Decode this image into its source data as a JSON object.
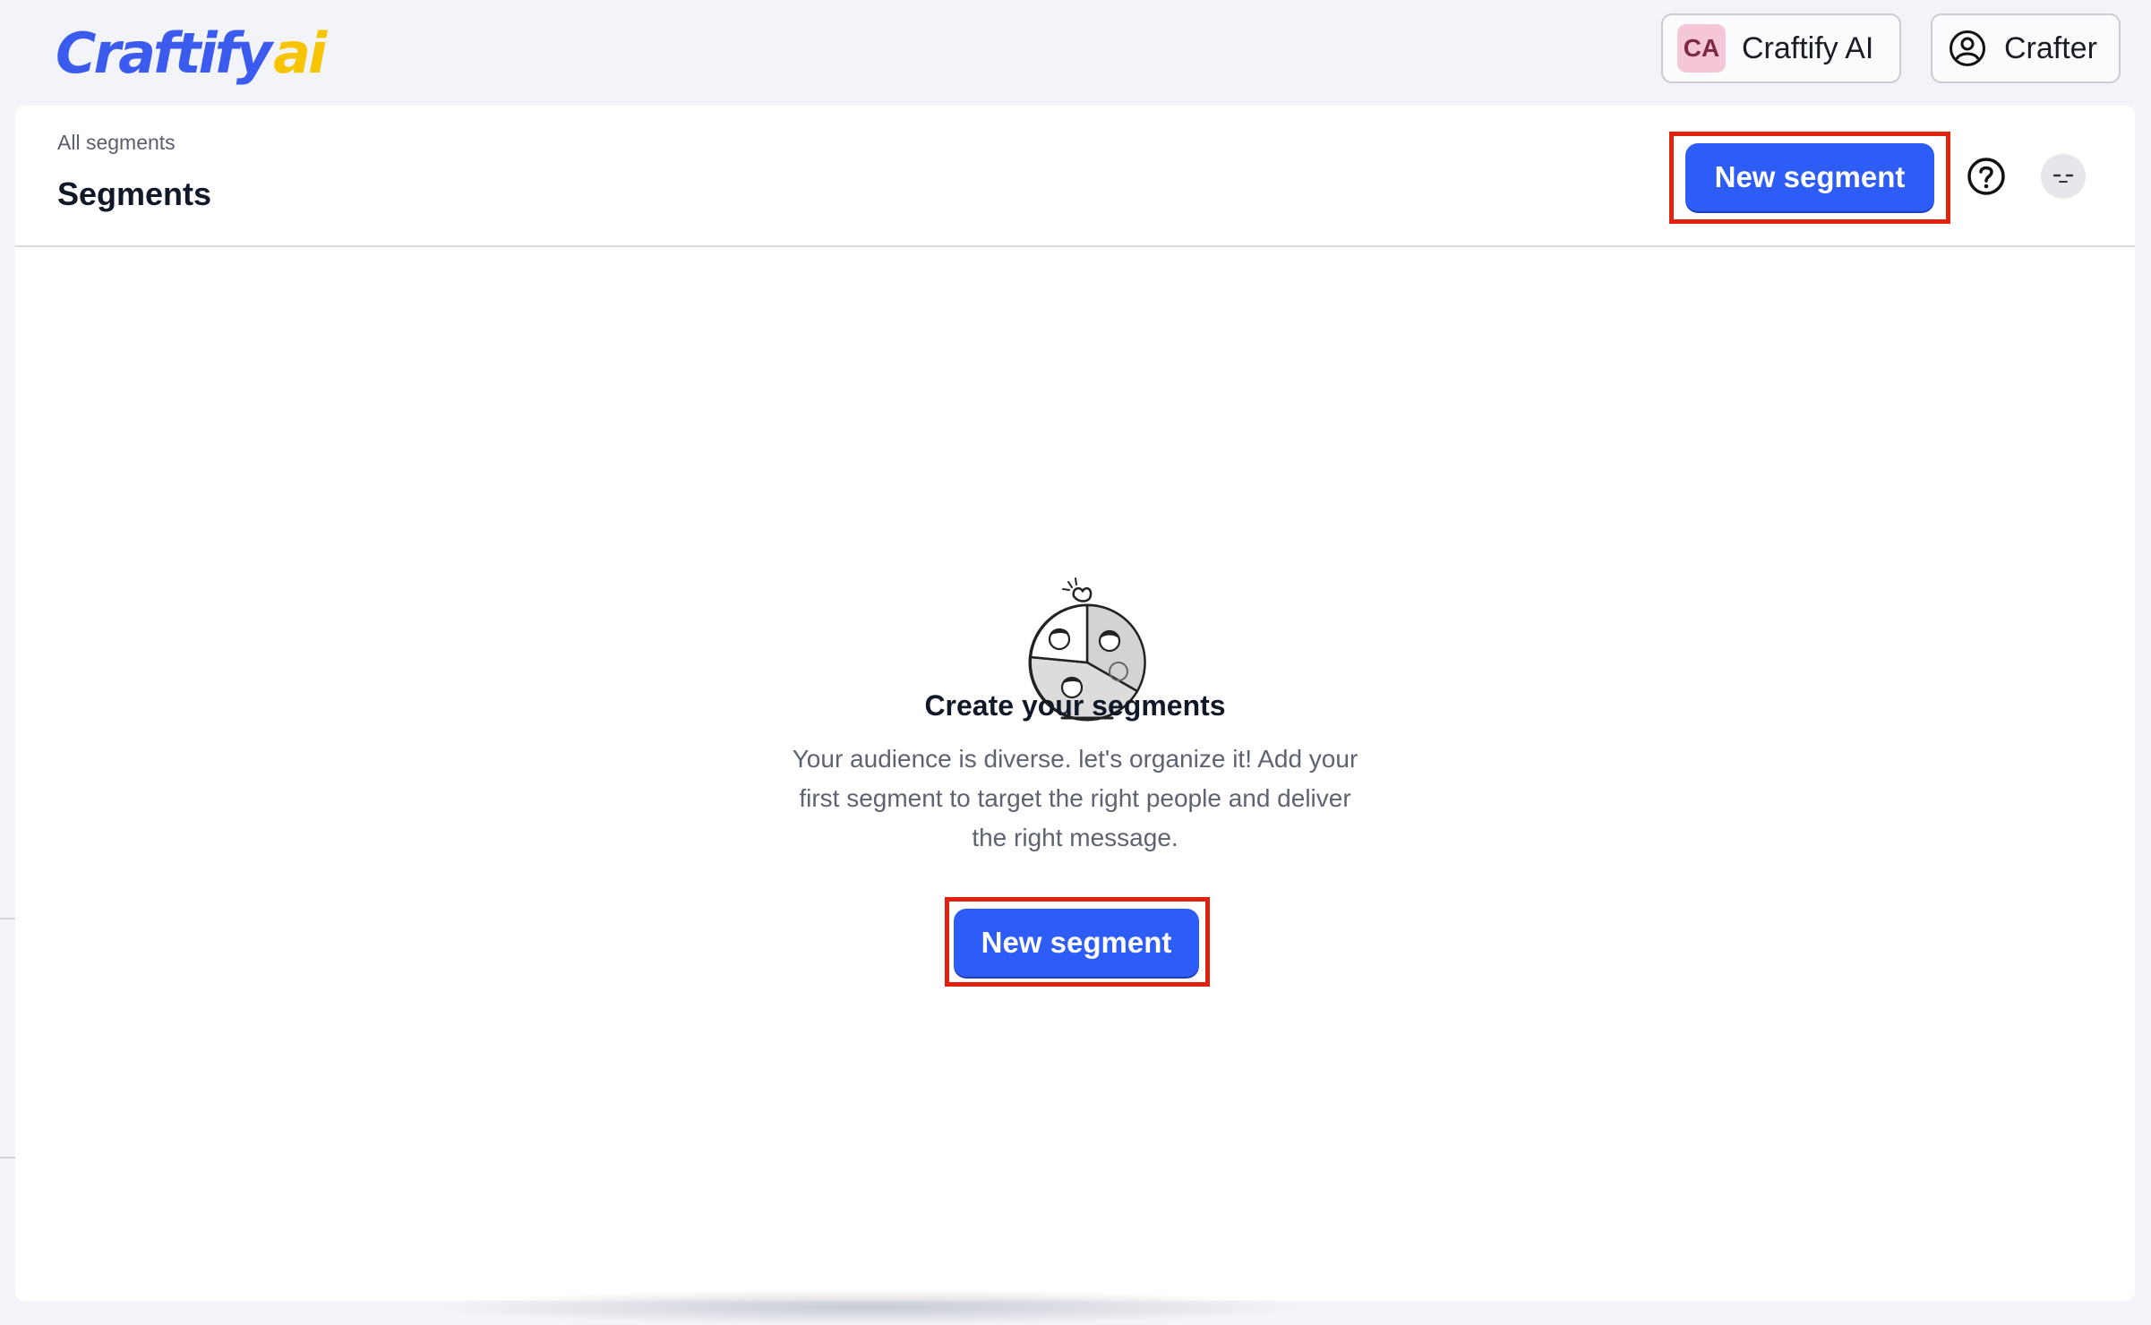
{
  "brand": {
    "logo_text": "Craftify",
    "logo_suffix": "ai",
    "primary_color": "#2e5cf6",
    "logo_suffix_color": "#f6c400"
  },
  "topbar": {
    "workspace": {
      "avatar_initials": "CA",
      "name": "Craftify AI"
    },
    "user": {
      "icon": "user-circle-icon",
      "name": "Crafter"
    }
  },
  "header": {
    "breadcrumb": "All segments",
    "title": "Segments",
    "new_segment_label": "New segment",
    "help_icon": "question-circle-icon"
  },
  "empty_state": {
    "illustration": "segments-pie-illustration",
    "title": "Create your segments",
    "description": "Your audience is diverse. let's organize it! Add your first segment to target the right people and deliver the right message.",
    "cta_label": "New segment"
  },
  "annotations": {
    "highlight_color": "#e0220f"
  }
}
